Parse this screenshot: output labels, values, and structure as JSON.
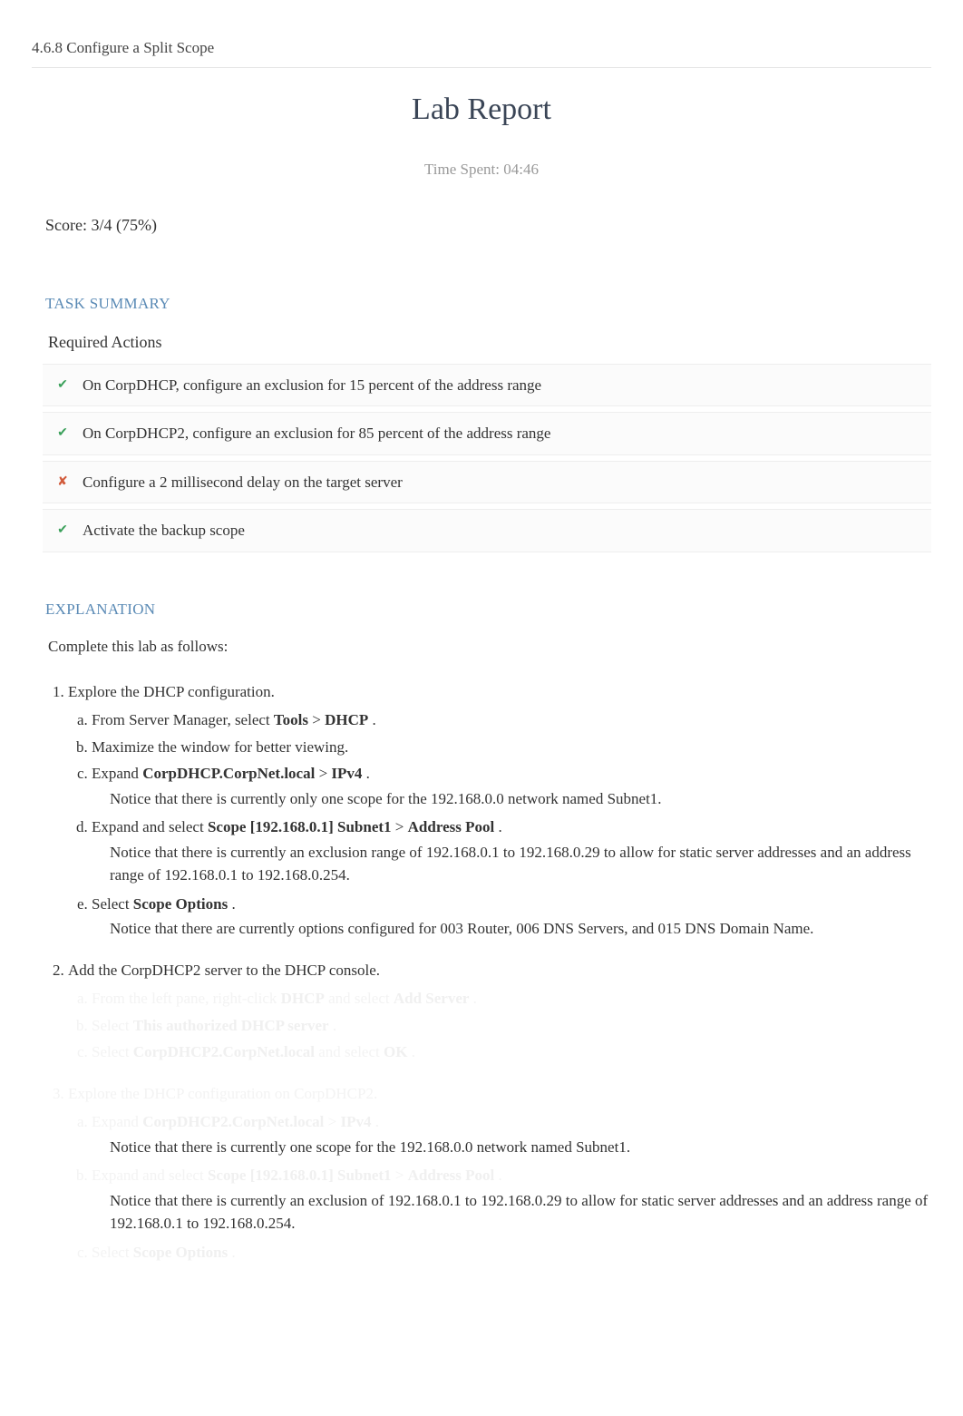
{
  "breadcrumb": "4.6.8 Configure a Split Scope",
  "title": "Lab Report",
  "time_spent": "Time Spent: 04:46",
  "score": "Score: 3/4 (75%)",
  "sections": {
    "task_summary_heading": "TASK SUMMARY",
    "required_actions_label": "Required Actions",
    "explanation_heading": "EXPLANATION",
    "explanation_intro": "Complete this lab as follows:"
  },
  "actions": [
    {
      "status": "pass",
      "text": "On CorpDHCP, configure an exclusion for 15 percent of the address range"
    },
    {
      "status": "pass",
      "text": "On CorpDHCP2, configure an exclusion for 85 percent of the address range"
    },
    {
      "status": "fail",
      "text": "Configure a 2 millisecond delay on the target server"
    },
    {
      "status": "pass",
      "text": "Activate the backup scope"
    }
  ],
  "steps": {
    "s1": {
      "title": "Explore the DHCP configuration.",
      "a_pre": "From Server Manager, select ",
      "a_bold1": "Tools",
      "a_mid": " > ",
      "a_bold2": "DHCP",
      "a_post": ".",
      "b": "Maximize the window for better viewing.",
      "c_pre": "Expand ",
      "c_bold1": "CorpDHCP.CorpNet.local",
      "c_mid": " > ",
      "c_bold2": "IPv4",
      "c_post": ".",
      "c_note": "Notice that there is currently only one scope for the 192.168.0.0 network named Subnet1.",
      "d_pre": "Expand and select ",
      "d_bold1": "Scope [192.168.0.1] Subnet1",
      "d_mid": " > ",
      "d_bold2": "Address Pool",
      "d_post": ".",
      "d_note": "Notice that there is currently an exclusion range of 192.168.0.1 to 192.168.0.29 to allow for static server addresses and an address range of 192.168.0.1 to 192.168.0.254.",
      "e_pre": "Select ",
      "e_bold1": "Scope Options",
      "e_post": ".",
      "e_note": "Notice that there are currently options configured for 003 Router, 006 DNS Servers, and 015 DNS Domain Name."
    },
    "s2": {
      "title": "Add the CorpDHCP2 server to the DHCP console.",
      "a_pre": "From the left pane, right-click ",
      "a_bold1": "DHCP",
      "a_mid": " and select ",
      "a_bold2": "Add Server",
      "a_post": ".",
      "b_pre": "Select ",
      "b_bold1": "This authorized DHCP server",
      "b_post": ".",
      "c_pre": "Select ",
      "c_bold1": "CorpDHCP2.CorpNet.local",
      "c_mid": " and select ",
      "c_bold2": "OK",
      "c_post": "."
    },
    "s3": {
      "title": "Explore the DHCP configuration on CorpDHCP2.",
      "a_pre": "Expand ",
      "a_bold1": "CorpDHCP2.CorpNet.local",
      "a_mid": " > ",
      "a_bold2": "IPv4",
      "a_post": ".",
      "a_note": "Notice that there is currently one scope for the 192.168.0.0 network named Subnet1.",
      "b_pre": "Expand and select ",
      "b_bold1": "Scope [192.168.0.1] Subnet1",
      "b_mid": " > ",
      "b_bold2": "Address Pool",
      "b_post": ".",
      "b_note": "Notice that there is currently an exclusion of 192.168.0.1 to 192.168.0.29 to allow for static server addresses and an address range of 192.168.0.1 to 192.168.0.254.",
      "c_pre": "Select ",
      "c_bold1": "Scope Options",
      "c_post": "."
    }
  }
}
